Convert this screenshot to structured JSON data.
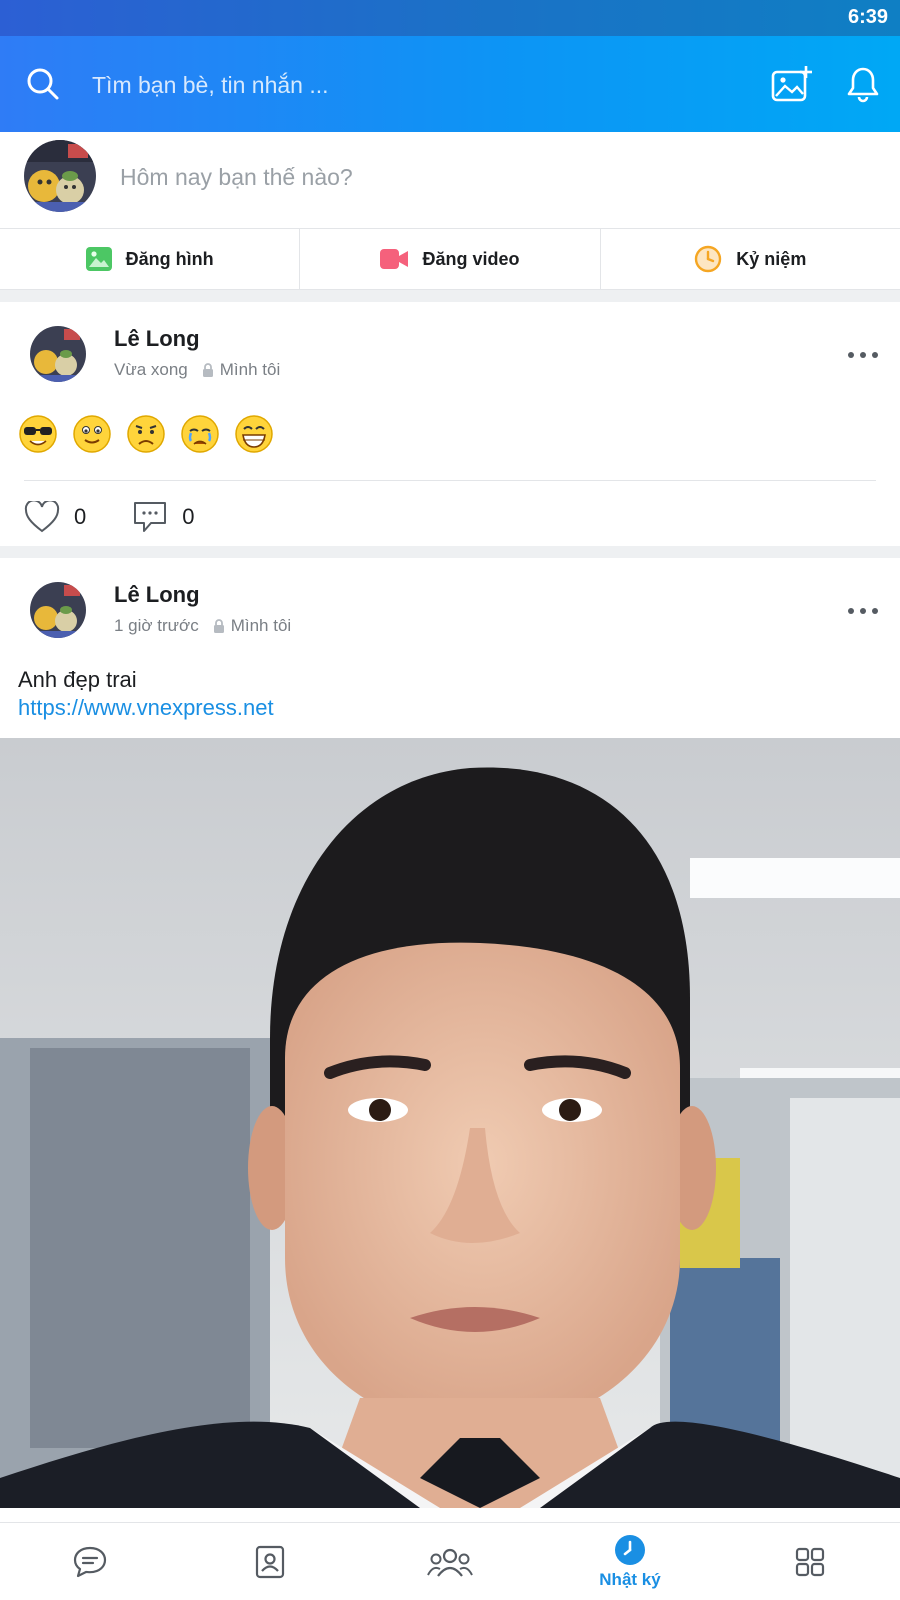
{
  "status_bar": {
    "time": "6:39"
  },
  "header": {
    "search": {
      "placeholder": "Tìm bạn bè, tin nhắn ...",
      "value": ""
    },
    "icons": [
      "search-icon",
      "add-photo-icon",
      "bell-icon"
    ]
  },
  "composer": {
    "placeholder": "Hôm nay bạn thế nào?",
    "actions": [
      {
        "label": "Đăng hình",
        "icon": "photo-icon",
        "color": "#4cc764"
      },
      {
        "label": "Đăng video",
        "icon": "video-icon",
        "color": "#f5617c"
      },
      {
        "label": "Kỷ niệm",
        "icon": "memory-clock-icon",
        "color": "#f5a623"
      }
    ]
  },
  "posts": [
    {
      "author": "Lê Long",
      "time": "Vừa xong",
      "privacy": "Mình tôi",
      "emojis": [
        "cool-sunglasses",
        "smiling",
        "sad",
        "crying",
        "grinning"
      ],
      "likes": "0",
      "comments": "0"
    },
    {
      "author": "Lê Long",
      "time": "1 giờ trước",
      "privacy": "Mình tôi",
      "text": "Anh đẹp trai",
      "link": "https://www.vnexpress.net",
      "photo": "selfie-photo"
    }
  ],
  "bottom_nav": {
    "items": [
      {
        "icon": "chat-icon",
        "label": ""
      },
      {
        "icon": "contacts-icon",
        "label": ""
      },
      {
        "icon": "groups-icon",
        "label": ""
      },
      {
        "icon": "timeline-icon",
        "label": "Nhật ký",
        "active": true
      },
      {
        "icon": "more-apps-icon",
        "label": ""
      }
    ]
  },
  "colors": {
    "accent": "#1a8fe3",
    "header_start": "#2f7cf6",
    "header_end": "#00a8f5"
  }
}
